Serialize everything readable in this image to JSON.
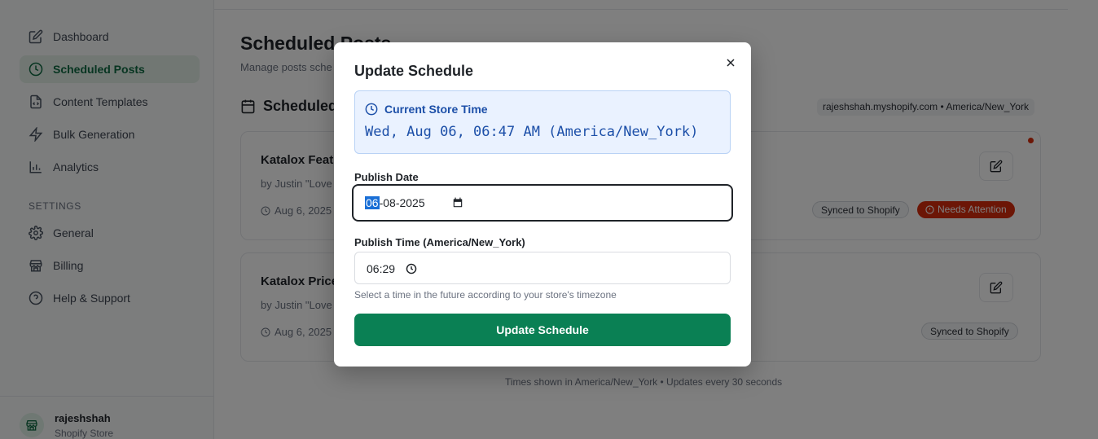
{
  "sidebar": {
    "items": [
      {
        "label": "Dashboard",
        "icon": "edit-square-icon"
      },
      {
        "label": "Scheduled Posts",
        "icon": "clock-icon",
        "active": true
      },
      {
        "label": "Content Templates",
        "icon": "file-icon"
      },
      {
        "label": "Bulk Generation",
        "icon": "bolt-icon"
      },
      {
        "label": "Analytics",
        "icon": "bar-chart-icon"
      }
    ],
    "settings_heading": "SETTINGS",
    "settings_items": [
      {
        "label": "General",
        "icon": "gear-icon"
      },
      {
        "label": "Billing",
        "icon": "store-icon"
      },
      {
        "label": "Help & Support",
        "icon": "help-icon"
      }
    ],
    "store": {
      "name": "rajeshshah",
      "type": "Shopify Store"
    }
  },
  "page": {
    "title": "Scheduled Posts",
    "subtitle": "Manage posts sche",
    "section_title": "Scheduled",
    "store_chip": "rajeshshah.myshopify.com • America/New_York"
  },
  "posts": [
    {
      "title": "Katalox Featu",
      "by": "by Justin \"Love",
      "date": "Aug 6, 2025",
      "badges": [
        "Synced to Shopify",
        "Needs Attention"
      ]
    },
    {
      "title": "Katalox Price",
      "by": "by Justin \"Love",
      "date": "Aug 6, 2025",
      "badges": [
        "Synced to Shopify"
      ]
    }
  ],
  "footer_note": "Times shown in America/New_York • Updates every 30 seconds",
  "modal": {
    "title": "Update Schedule",
    "current_time_label": "Current Store Time",
    "current_time_value": "Wed, Aug 06, 06:47 AM (America/New_York)",
    "publish_date_label": "Publish Date",
    "publish_date_selected": "06",
    "publish_date_rest": "-08-2025",
    "publish_time_label": "Publish Time (America/New_York)",
    "publish_time_value": "06:29",
    "help_text": "Select a time in the future according to your store's timezone",
    "submit_label": "Update Schedule"
  },
  "colors": {
    "brand": "#0a8054",
    "info": "#1c4fa8",
    "danger": "#d82c0d"
  }
}
